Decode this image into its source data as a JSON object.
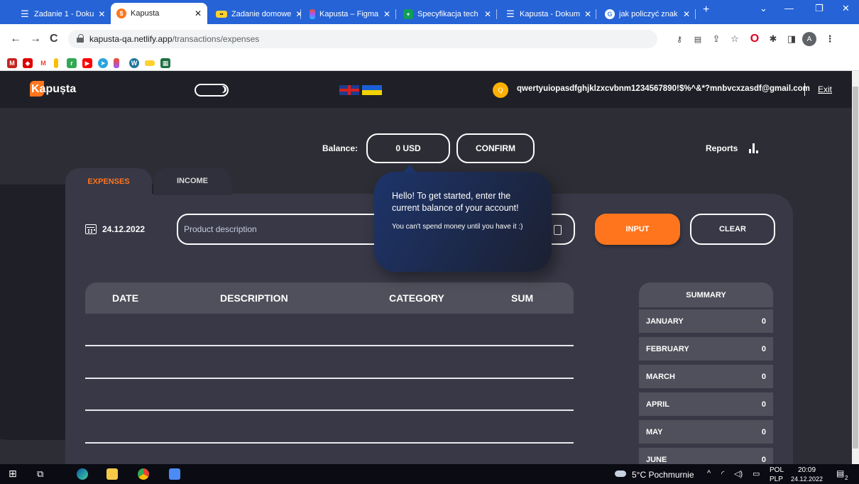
{
  "browser": {
    "tabs": [
      {
        "label": "Zadanie 1 - Doku",
        "icon": "docs-icon",
        "color": "#4285f4"
      },
      {
        "label": "Kapusta",
        "icon": "kapusta-icon",
        "color": "#ff751d"
      },
      {
        "label": "Zadanie domowe",
        "icon": "miro-icon",
        "color": "#ffd02f"
      },
      {
        "label": "Kapusta – Figma",
        "icon": "figma-icon",
        "color": "#a259ff"
      },
      {
        "label": "Specyfikacja tech",
        "icon": "sheets-icon",
        "color": "#0f9d58"
      },
      {
        "label": "Kapusta - Dokum",
        "icon": "docs-icon",
        "color": "#4285f4"
      },
      {
        "label": "jak policzyć znak",
        "icon": "google-icon",
        "color": "#ffffff"
      }
    ],
    "new_tab": "+",
    "url_host": "kapusta-qa.netlify.app",
    "url_path": "/transactions/expenses",
    "profile_initial": "A"
  },
  "app": {
    "logo": "Kapușta",
    "avatar_initial": "Q",
    "user_email": "qwertyuiopasdfghjklzxcvbnm1234567890!$%^&*?mnbvcxzasdf@gmail.com",
    "exit": "Exit",
    "balance_label": "Balance:",
    "balance_value": "0 USD",
    "confirm": "CONFIRM",
    "reports": "Reports",
    "tabs": {
      "expenses": "EXPENSES",
      "income": "INCOME"
    },
    "date": "24.12.2022",
    "description_placeholder": "Product description",
    "input_button": "INPUT",
    "clear_button": "CLEAR",
    "tooltip": {
      "title": "Hello! To get started, enter the current balance of your account!",
      "subtitle": "You can't spend money until you have it :)"
    },
    "table_headers": {
      "date": "DATE",
      "description": "DESCRIPTION",
      "category": "CATEGORY",
      "sum": "SUM"
    },
    "summary": {
      "title": "SUMMARY",
      "rows": [
        {
          "month": "JANUARY",
          "value": "0"
        },
        {
          "month": "FEBRUARY",
          "value": "0"
        },
        {
          "month": "MARCH",
          "value": "0"
        },
        {
          "month": "APRIL",
          "value": "0"
        },
        {
          "month": "MAY",
          "value": "0"
        },
        {
          "month": "JUNE",
          "value": "0"
        }
      ]
    },
    "accent_color": "#ff751d"
  },
  "taskbar": {
    "weather": "5°C Pochmurnie",
    "lang_top": "POL",
    "lang_bottom": "PLP",
    "time": "20:09",
    "date": "24.12.2022",
    "notifications": "2"
  }
}
